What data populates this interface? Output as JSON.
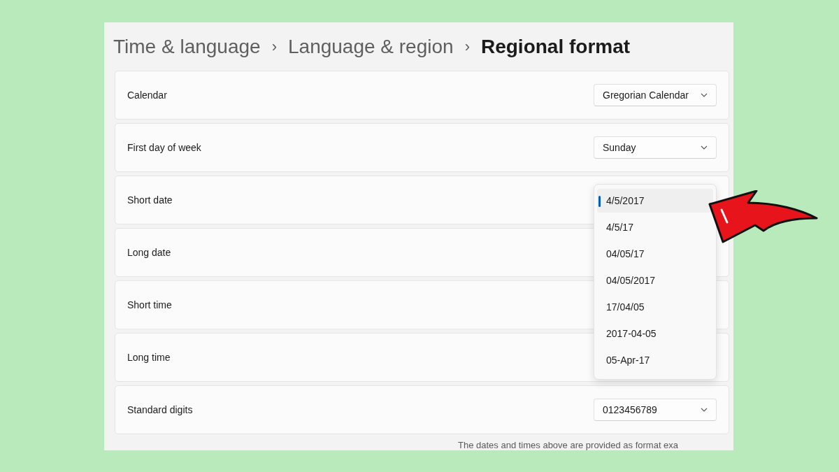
{
  "breadcrumb": [
    {
      "label": "Time & language",
      "current": false
    },
    {
      "label": "Language & region",
      "current": false
    },
    {
      "label": "Regional format",
      "current": true
    }
  ],
  "separator": "›",
  "settings": [
    {
      "label": "Calendar",
      "value": "Gregorian Calendar"
    },
    {
      "label": "First day of week",
      "value": "Sunday"
    },
    {
      "label": "Short date",
      "open": true
    },
    {
      "label": "Long date"
    },
    {
      "label": "Short time"
    },
    {
      "label": "Long time"
    },
    {
      "label": "Standard digits",
      "value": "0123456789"
    }
  ],
  "dropdown_options": [
    {
      "label": "4/5/2017",
      "selected": true
    },
    {
      "label": "4/5/17",
      "selected": false
    },
    {
      "label": "04/05/17",
      "selected": false
    },
    {
      "label": "04/05/2017",
      "selected": false
    },
    {
      "label": "17/04/05",
      "selected": false
    },
    {
      "label": "2017-04-05",
      "selected": false
    },
    {
      "label": "05-Apr-17",
      "selected": false
    }
  ],
  "footnote": "The dates and times above are provided as format exa"
}
